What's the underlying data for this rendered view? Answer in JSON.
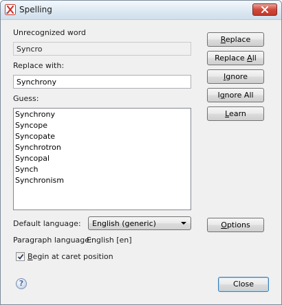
{
  "window": {
    "title": "Spelling"
  },
  "unrecognized": {
    "label": "Unrecognized word",
    "value": "Syncro"
  },
  "replace_with": {
    "label": "Replace with:",
    "value": "Synchrony"
  },
  "guess": {
    "label": "Guess:",
    "items": [
      "Synchrony",
      "Syncope",
      "Syncopate",
      "Synchrotron",
      "Syncopal",
      "Synch",
      "Synchronism"
    ]
  },
  "buttons": {
    "replace": {
      "pre": "",
      "key": "R",
      "post": "eplace"
    },
    "replace_all": {
      "pre": "Replace ",
      "key": "A",
      "post": "ll"
    },
    "ignore": {
      "pre": "",
      "key": "I",
      "post": "gnore"
    },
    "ignore_all": {
      "pre": "I",
      "key": "g",
      "post": "nore All"
    },
    "learn": {
      "pre": "",
      "key": "L",
      "post": "earn"
    },
    "options": {
      "pre": "",
      "key": "O",
      "post": "ptions"
    },
    "close": {
      "label": "Close"
    }
  },
  "default_language": {
    "label": "Default language:",
    "value": "English (generic)"
  },
  "paragraph_language": {
    "label": "Paragraph language:",
    "value": "English [en]"
  },
  "begin_at_caret": {
    "pre": "",
    "key": "B",
    "post": "egin at caret position",
    "checked": true
  },
  "help": {
    "glyph": "?"
  }
}
